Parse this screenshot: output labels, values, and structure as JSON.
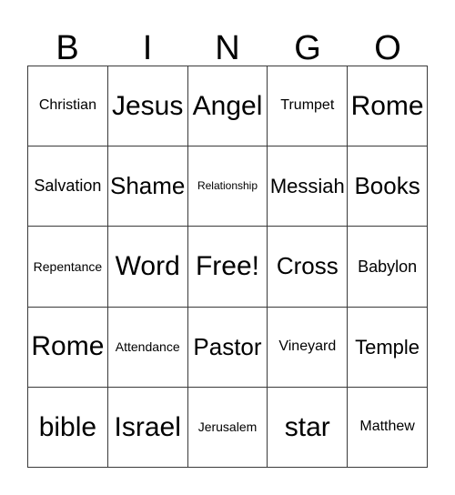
{
  "card": {
    "header_letters": [
      "B",
      "I",
      "N",
      "G",
      "O"
    ],
    "free_space_label": "Free!",
    "rows": [
      [
        {
          "text": "Christian",
          "size": "md"
        },
        {
          "text": "Jesus",
          "size": "3xl"
        },
        {
          "text": "Angel",
          "size": "3xl"
        },
        {
          "text": "Trumpet",
          "size": "md"
        },
        {
          "text": "Rome",
          "size": "3xl"
        }
      ],
      [
        {
          "text": "Salvation",
          "size": "lg"
        },
        {
          "text": "Shame",
          "size": "2xl"
        },
        {
          "text": "Relationship",
          "size": "xs"
        },
        {
          "text": "Messiah",
          "size": "xl"
        },
        {
          "text": "Books",
          "size": "2xl"
        }
      ],
      [
        {
          "text": "Repentance",
          "size": "sm"
        },
        {
          "text": "Word",
          "size": "3xl"
        },
        {
          "text": "Free!",
          "size": "3xl"
        },
        {
          "text": "Cross",
          "size": "2xl"
        },
        {
          "text": "Babylon",
          "size": "lg"
        }
      ],
      [
        {
          "text": "Rome",
          "size": "3xl"
        },
        {
          "text": "Attendance",
          "size": "sm"
        },
        {
          "text": "Pastor",
          "size": "2xl"
        },
        {
          "text": "Vineyard",
          "size": "md"
        },
        {
          "text": "Temple",
          "size": "xl"
        }
      ],
      [
        {
          "text": "bible",
          "size": "3xl"
        },
        {
          "text": "Israel",
          "size": "3xl"
        },
        {
          "text": "Jerusalem",
          "size": "sm"
        },
        {
          "text": "star",
          "size": "3xl"
        },
        {
          "text": "Matthew",
          "size": "md"
        }
      ]
    ]
  },
  "colors": {
    "background": "#ffffff",
    "cell_background": "#ffffff",
    "border": "#3a3a3a",
    "text": "#000000"
  }
}
